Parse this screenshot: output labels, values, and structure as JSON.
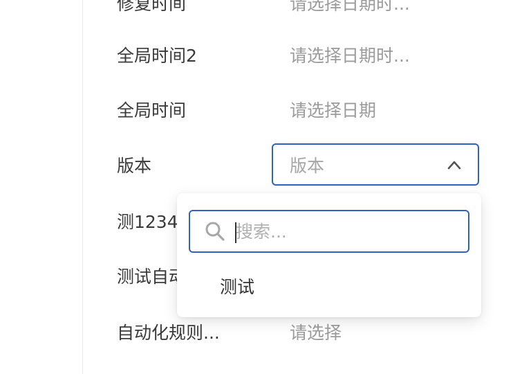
{
  "form": {
    "rows": [
      {
        "label": "修复时间",
        "value": "请选择日期时..."
      },
      {
        "label": "全局时间2",
        "value": "请选择日期时..."
      },
      {
        "label": "全局时间",
        "value": "请选择日期"
      },
      {
        "label": "版本"
      },
      {
        "label": "测1234"
      },
      {
        "label": "测试自动"
      },
      {
        "label": "自动化规则...",
        "value": "请选择"
      }
    ]
  },
  "select": {
    "placeholder": "版本",
    "state": "open",
    "accent_color": "#2e62c2"
  },
  "dropdown": {
    "search": {
      "placeholder": "搜索...",
      "value": "",
      "icon": "search-icon"
    },
    "options": [
      {
        "label": "测试"
      }
    ]
  }
}
